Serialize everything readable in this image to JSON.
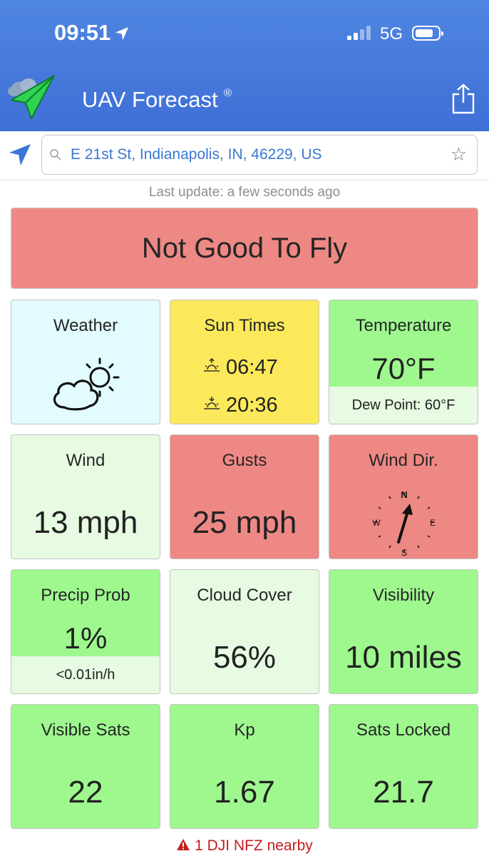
{
  "status_bar": {
    "time": "09:51",
    "network": "5G"
  },
  "app": {
    "title": "UAV Forecast",
    "registered_mark": "®"
  },
  "search": {
    "value": "E 21st St, Indianapolis, IN, 46229, US"
  },
  "last_update": "Last update: a few seconds ago",
  "verdict": "Not Good To Fly",
  "tiles": {
    "weather": {
      "label": "Weather",
      "icon": "partly-sunny-icon"
    },
    "sun_times": {
      "label": "Sun Times",
      "sunrise": "06:47",
      "sunset": "20:36"
    },
    "temperature": {
      "label": "Temperature",
      "value": "70°F",
      "dew_point": "Dew Point: 60°F"
    },
    "wind": {
      "label": "Wind",
      "value": "13 mph"
    },
    "gusts": {
      "label": "Gusts",
      "value": "25 mph"
    },
    "wind_dir": {
      "label": "Wind Dir.",
      "compass": {
        "n": "N",
        "e": "E",
        "s": "S",
        "w": "W"
      }
    },
    "precip_prob": {
      "label": "Precip Prob",
      "value": "1%",
      "rate": "<0.01in/h"
    },
    "cloud_cover": {
      "label": "Cloud Cover",
      "value": "56%"
    },
    "visibility": {
      "label": "Visibility",
      "value": "10 miles"
    },
    "visible_sats": {
      "label": "Visible Sats",
      "value": "22"
    },
    "kp": {
      "label": "Kp",
      "value": "1.67"
    },
    "sats_locked": {
      "label": "Sats Locked",
      "value": "21.7"
    }
  },
  "warning": {
    "icon": "warning-triangle-icon",
    "text": "1 DJI NFZ nearby"
  },
  "colors": {
    "header_blue": "#4278d8",
    "bad_red": "#ee8884",
    "good_green": "#9ef88e",
    "neutral_green": "#e6fbe2",
    "sun_yellow": "#fbe95b",
    "weather_cyan": "#e2fbff",
    "link_blue": "#3a78d4",
    "warning_red": "#c41c1c"
  }
}
